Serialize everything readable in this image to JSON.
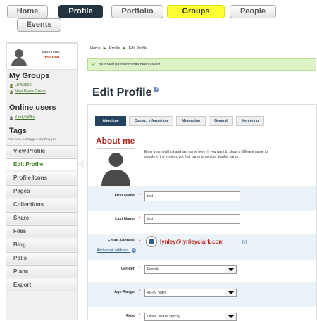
{
  "nav": {
    "home": "Home",
    "profile": "Profile",
    "portfolio": "Portfolio",
    "groups": "Groups",
    "people": "People",
    "events": "Events"
  },
  "sidebar": {
    "welcome": "Welcome,",
    "username": "test test",
    "my_groups": "My Groups",
    "groups": [
      "LEAD210",
      "New Users Group"
    ],
    "online_users": "Online users",
    "users": [
      "Kirsty Willis"
    ],
    "tags": "Tags",
    "tags_note": "You have not tagged anything yet",
    "items": [
      "View Profile",
      "Edit Profile",
      "Profile Icons",
      "Pages",
      "Collections",
      "Share",
      "Files",
      "Blog",
      "Polls",
      "Plans",
      "Export"
    ]
  },
  "breadcrumb": {
    "home": "Home",
    "profile": "Profile",
    "edit": "Edit Profile"
  },
  "notice": "Your new password has been saved",
  "page_title": "Edit Profile",
  "tabs": [
    "About me",
    "Contact information",
    "Messaging",
    "General",
    "Mentoring"
  ],
  "about": {
    "heading": "About me",
    "text": "Enter your real first and last name here. If you want to show a different name to people in the system, put that name in as your display name."
  },
  "form": {
    "first_name_label": "First Name",
    "first_name": "test",
    "last_name_label": "Last Name",
    "last_name": "test",
    "email_label": "Email Address",
    "email": "lynley@lynleyclark.com",
    "email_remove": "[x]",
    "add_email": "Add email address",
    "gender_label": "Gender",
    "gender": "Female",
    "age_label": "Age Range",
    "age": "40-49 Years",
    "role_label": "Role",
    "role": "Other, please specify",
    "required": "*"
  },
  "colors": {
    "accent_dark": "#23333f",
    "highlight": "#ffff33",
    "heading_red": "#b02a20",
    "link_green": "#3b8020"
  }
}
